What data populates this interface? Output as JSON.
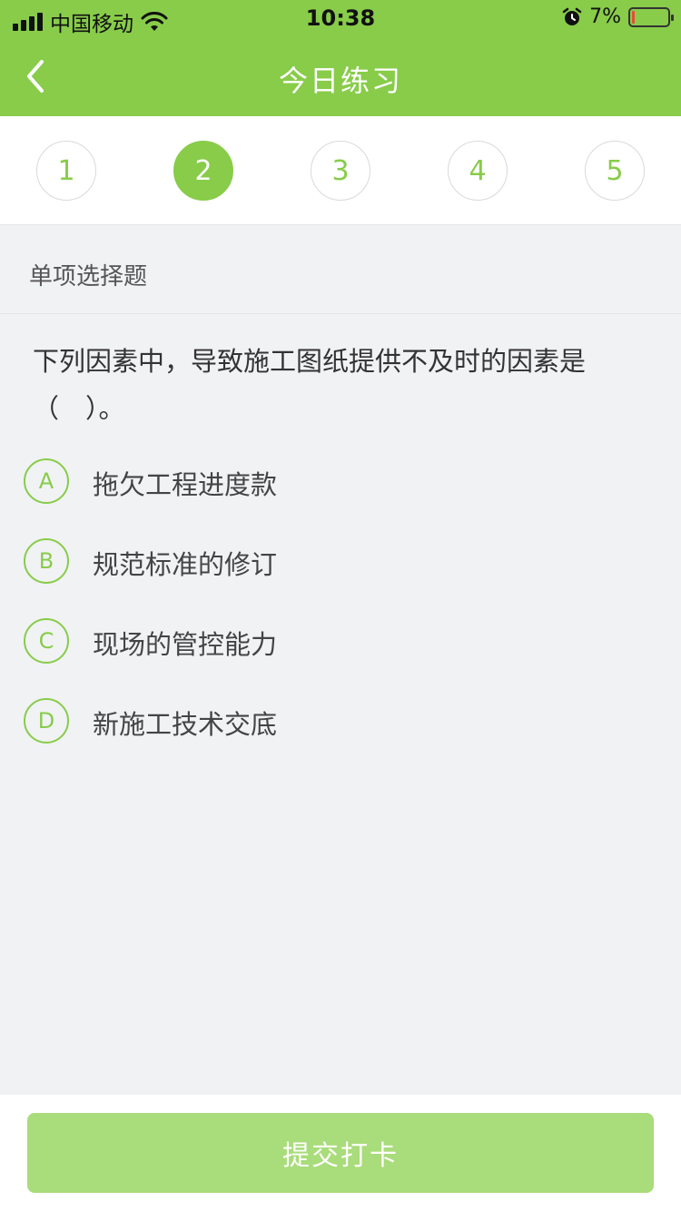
{
  "status_bar": {
    "carrier": "中国移动",
    "time": "10:38",
    "battery_text": "7%",
    "battery_level": 0.07,
    "battery_color": "#e94a3a"
  },
  "nav": {
    "back_icon": "chevron-left-icon",
    "title": "今日练习"
  },
  "steps": [
    {
      "label": "1",
      "active": false
    },
    {
      "label": "2",
      "active": true
    },
    {
      "label": "3",
      "active": false
    },
    {
      "label": "4",
      "active": false
    },
    {
      "label": "5",
      "active": false
    }
  ],
  "question": {
    "type": "单项选择题",
    "text": "下列因素中，导致施工图纸提供不及时的因素是（　）。",
    "options": [
      {
        "letter": "A",
        "text": "拖欠工程进度款"
      },
      {
        "letter": "B",
        "text": "规范标准的修订"
      },
      {
        "letter": "C",
        "text": "现场的管控能力"
      },
      {
        "letter": "D",
        "text": "新施工技术交底"
      }
    ]
  },
  "footer": {
    "submit_label": "提交打卡"
  },
  "colors": {
    "accent": "#88cc4a",
    "button_disabled": "#a9dc7a",
    "background": "#f1f2f4"
  }
}
